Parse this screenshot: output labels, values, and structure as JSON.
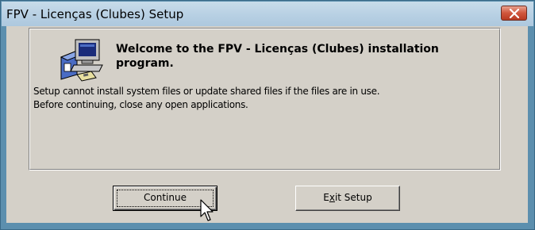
{
  "window": {
    "title": "FPV - Licenças (Clubes) Setup"
  },
  "welcome": {
    "heading": "Welcome to the FPV - Licenças (Clubes) installation program.",
    "line1": "Setup cannot install system files or update shared files if the files are in use.",
    "line2": "Before continuing, close any open applications."
  },
  "buttons": {
    "continue_label": "Continue",
    "exit_label_pre": "E",
    "exit_label_mnemonic": "x",
    "exit_label_post": "it Setup"
  },
  "icons": {
    "setup": "setup-computer-icon",
    "close": "close-icon",
    "cursor": "mouse-pointer-icon"
  },
  "colors": {
    "titlebar": "#b9d1e4",
    "dialog_face": "#d4d0c8",
    "close_button": "#d0553c",
    "frame": "#5c8fae"
  }
}
